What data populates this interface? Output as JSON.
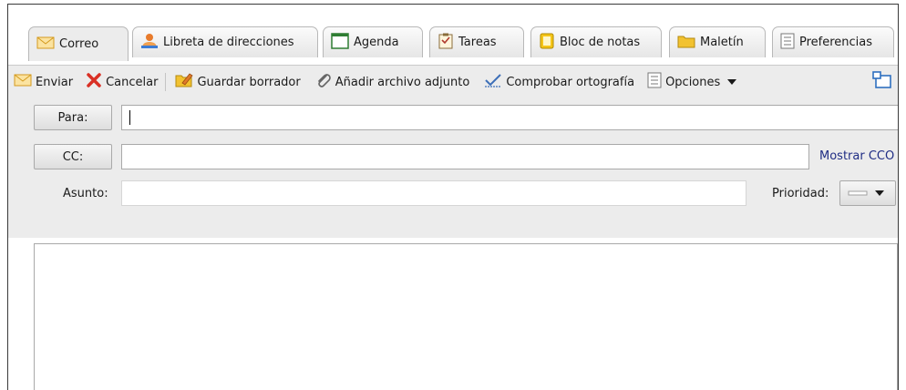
{
  "tabs": [
    {
      "label": "Correo",
      "icon": "envelope-icon"
    },
    {
      "label": "Libreta de direcciones",
      "icon": "contacts-icon"
    },
    {
      "label": "Agenda",
      "icon": "calendar-icon"
    },
    {
      "label": "Tareas",
      "icon": "tasks-icon"
    },
    {
      "label": "Bloc de notas",
      "icon": "notebook-icon"
    },
    {
      "label": "Maletín",
      "icon": "folder-icon"
    },
    {
      "label": "Preferencias",
      "icon": "preferences-icon"
    }
  ],
  "toolbar": {
    "send_label": "Enviar",
    "cancel_label": "Cancelar",
    "save_draft_label": "Guardar borrador",
    "attach_label": "Añadir archivo adjunto",
    "spellcheck_label": "Comprobar ortografía",
    "options_label": "Opciones"
  },
  "compose": {
    "to_label": "Para:",
    "to_value": "",
    "cc_label": "CC:",
    "cc_value": "",
    "show_bcc_label": "Mostrar CCO",
    "subject_label": "Asunto:",
    "subject_value": "",
    "priority_label": "Prioridad:",
    "body_value": ""
  },
  "colors": {
    "link": "#1f2d84",
    "envelope": "#e8b84a",
    "cancel": "#d93025",
    "folder": "#e9b92c"
  }
}
